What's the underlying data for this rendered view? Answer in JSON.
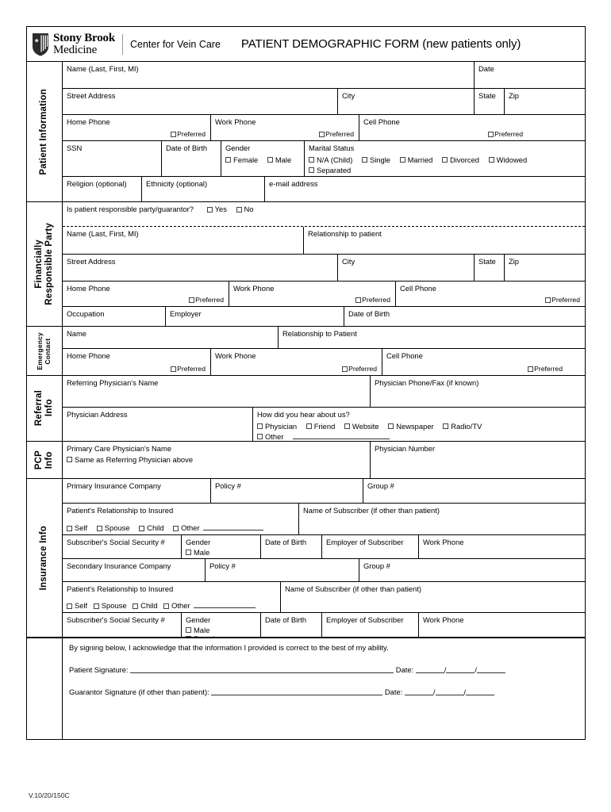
{
  "header": {
    "brand_line1": "Stony Brook",
    "brand_line2": "Medicine",
    "department": "Center for Vein Care",
    "title": "PATIENT DEMOGRAPHIC FORM (new patients only)"
  },
  "sections": {
    "patient": "Patient Information",
    "financial": "Financially\nResponsible Party",
    "emergency": "Emergency\nContact",
    "referral": "Referral\nInfo",
    "pcp": "PCP\nInfo",
    "insurance": "Insurance Info"
  },
  "patient": {
    "name": "Name (Last, First, MI)",
    "date": "Date",
    "street": "Street Address",
    "city": "City",
    "state": "State",
    "zip": "Zip",
    "home_phone": "Home Phone",
    "work_phone": "Work Phone",
    "cell_phone": "Cell Phone",
    "preferred": "Preferred",
    "ssn": "SSN",
    "dob": "Date of Birth",
    "gender": "Gender",
    "gender_options": [
      "Female",
      "Male"
    ],
    "marital": "Marital Status",
    "marital_options": [
      "N/A (Child)",
      "Single",
      "Married",
      "Divorced",
      "Widowed",
      "Separated"
    ],
    "religion": "Religion (optional)",
    "ethnicity": "Ethnicity (optional)",
    "email": "e-mail address"
  },
  "financial": {
    "question": "Is patient responsible party/guarantor?",
    "yes": "Yes",
    "no": "No",
    "name": "Name (Last, First, MI)",
    "relationship": "Relationship to patient",
    "street": "Street Address",
    "city": "City",
    "state": "State",
    "zip": "Zip",
    "home_phone": "Home Phone",
    "work_phone": "Work Phone",
    "cell_phone": "Cell Phone",
    "preferred": "Preferred",
    "occupation": "Occupation",
    "employer": "Employer",
    "dob": "Date of Birth"
  },
  "emergency": {
    "name": "Name",
    "relationship": "Relationship to Patient",
    "home_phone": "Home Phone",
    "work_phone": "Work Phone",
    "cell_phone": "Cell Phone",
    "preferred": "Preferred"
  },
  "referral": {
    "physician_name": "Referring Physician's Name",
    "physician_phone": "Physician Phone/Fax (if known)",
    "physician_address": "Physician Address",
    "hear_about": "How did you hear about us?",
    "hear_options": [
      "Physician",
      "Friend",
      "Website",
      "Newspaper",
      "Radio/TV"
    ],
    "other": "Other"
  },
  "pcp": {
    "name": "Primary Care Physician's Name",
    "same_as": "Same as Referring Physician above",
    "number": "Physician Number"
  },
  "insurance": {
    "primary_company": "Primary Insurance Company",
    "secondary_company": "Secondary Insurance Company",
    "policy": "Policy #",
    "group": "Group #",
    "relationship": "Patient's Relationship to Insured",
    "rel_options": [
      "Self",
      "Spouse",
      "Child",
      "Other"
    ],
    "subscriber_name": "Name of Subscriber (if other than patient)",
    "subscriber_ssn": "Subscriber's Social Security #",
    "gender": "Gender",
    "gender_options": [
      "Male",
      "Female"
    ],
    "dob": "Date of Birth",
    "employer": "Employer of Subscriber",
    "work_phone": "Work Phone"
  },
  "signature": {
    "statement": "By signing below, I acknowledge that the information I provided is correct to the best of my ability.",
    "patient_label": "Patient Signature:",
    "guarantor_label": "Guarantor Signature (if other than patient):",
    "date_label": "Date:"
  },
  "footer": {
    "version": "V.10/20/150C"
  }
}
